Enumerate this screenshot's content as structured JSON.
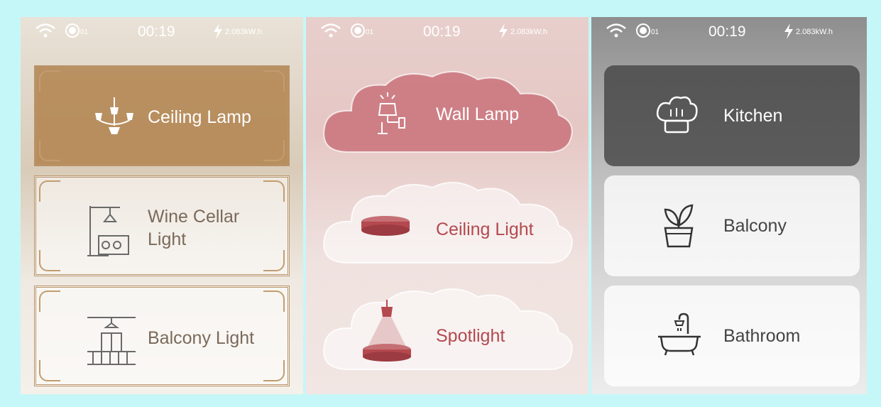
{
  "status_bar": {
    "channel": "01",
    "time": "00:19",
    "energy": "2.083kW.h"
  },
  "panels": [
    {
      "items": [
        {
          "label": "Ceiling Lamp",
          "icon": "chandelier-icon",
          "active": true
        },
        {
          "label_line1": "Wine Cellar",
          "label_line2": "Light",
          "icon": "wine-cellar-light-icon",
          "active": false
        },
        {
          "label": "Balcony Light",
          "icon": "balcony-light-icon",
          "active": false
        }
      ]
    },
    {
      "items": [
        {
          "label": "Wall Lamp",
          "icon": "wall-lamp-icon",
          "active": true
        },
        {
          "label": "Ceiling Light",
          "icon": "ceiling-light-icon",
          "active": false
        },
        {
          "label": "Spotlight",
          "icon": "spotlight-icon",
          "active": false
        }
      ]
    },
    {
      "items": [
        {
          "label": "Kitchen",
          "icon": "chef-hat-icon",
          "active": true
        },
        {
          "label": "Balcony",
          "icon": "potted-plant-icon",
          "active": false
        },
        {
          "label": "Bathroom",
          "icon": "bathtub-icon",
          "active": false
        }
      ]
    }
  ],
  "colors": {
    "background": "#c6f7f8",
    "gold_accent": "#b1824e",
    "rose_accent": "#b4494f",
    "dark_active": "#464646"
  }
}
